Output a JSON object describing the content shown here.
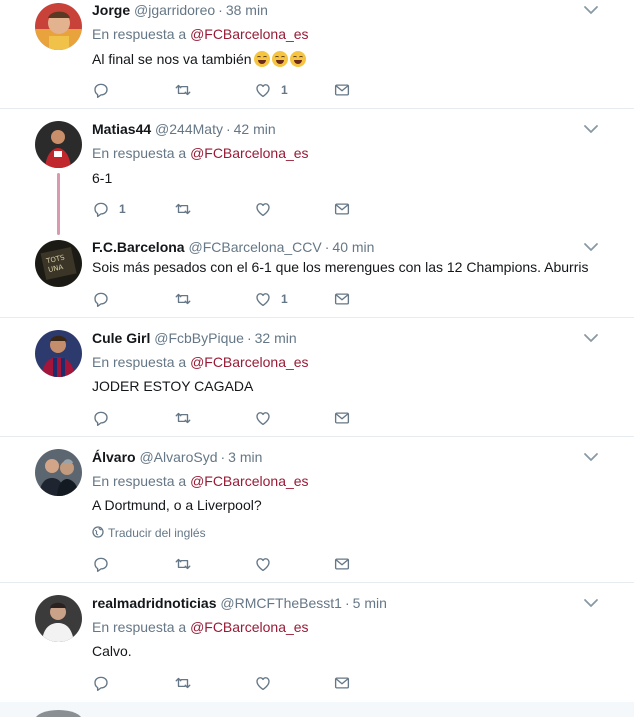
{
  "tweets": [
    {
      "name": "Jorge",
      "handle": "@jgarridoreo",
      "time": "38 min",
      "reply_prefix": "En respuesta a ",
      "reply_to": "@FCBarcelona_es",
      "text": "Al final se nos va también",
      "emoji": [
        "face-with-tears-of-joy",
        "face-with-tears-of-joy",
        "face-with-tears-of-joy"
      ],
      "reply_count": "",
      "retweet_count": "",
      "like_count": "1"
    },
    {
      "name": "Matias44",
      "handle": "@244Maty",
      "time": "42 min",
      "reply_prefix": "En respuesta a ",
      "reply_to": "@FCBarcelona_es",
      "text": "6-1",
      "reply_count": "1",
      "retweet_count": "",
      "like_count": ""
    },
    {
      "name": "F.C.Barcelona",
      "handle": "@FCBarcelona_CCV",
      "time": "40 min",
      "text": "Sois más pesados con el 6-1 que los merengues con las 12 Champions. Aburris",
      "reply_count": "",
      "retweet_count": "",
      "like_count": "1"
    },
    {
      "name": "Cule Girl",
      "handle": "@FcbByPique",
      "time": "32 min",
      "reply_prefix": "En respuesta a ",
      "reply_to": "@FCBarcelona_es",
      "text": "JODER ESTOY CAGADA",
      "reply_count": "",
      "retweet_count": "",
      "like_count": ""
    },
    {
      "name": "Álvaro",
      "handle": "@AlvaroSyd",
      "time": "3 min",
      "reply_prefix": "En respuesta a ",
      "reply_to": "@FCBarcelona_es",
      "text": "A Dortmund, o a Liverpool?",
      "translate": "Traducir del inglés",
      "reply_count": "",
      "retweet_count": "",
      "like_count": ""
    },
    {
      "name": "realmadridnoticias",
      "handle": "@RMCFTheBesst1",
      "time": "5 min",
      "reply_prefix": "En respuesta a ",
      "reply_to": "@FCBarcelona_es",
      "text": "Calvo.",
      "reply_count": "",
      "retweet_count": "",
      "like_count": ""
    }
  ],
  "colors": {
    "mention": "#981b36",
    "muted": "#657786",
    "divider": "#e6ecf0",
    "thread_line": "#d99aae"
  },
  "icons": {
    "reply": "reply-icon",
    "retweet": "retweet-icon",
    "like": "heart-icon",
    "dm": "envelope-icon",
    "more": "chevron-down-icon",
    "translate": "globe-icon"
  }
}
